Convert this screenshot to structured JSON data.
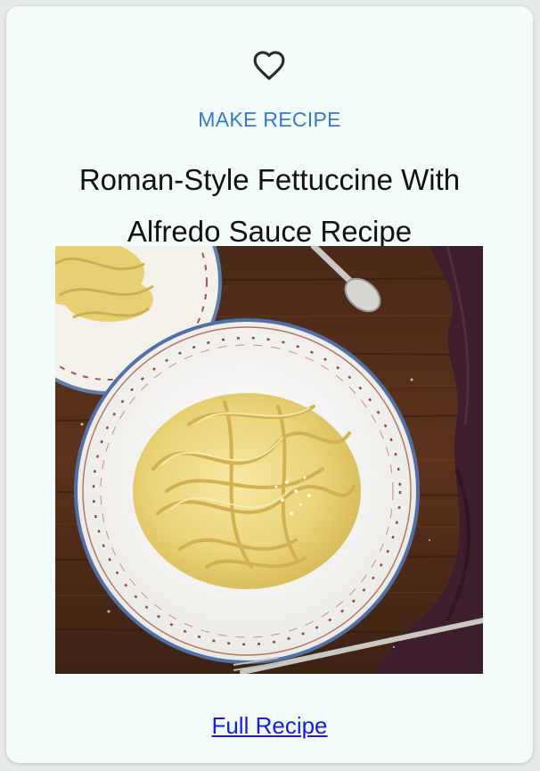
{
  "card": {
    "favorite_icon": "heart-outline-icon",
    "kicker": "MAKE RECIPE",
    "title": "Roman-Style Fettuccine With Alfredo Sauce Recipe",
    "image_alt": "Roman-Style Fettuccine With Alfredo Sauce",
    "link_label": "Full Recipe"
  },
  "colors": {
    "card_bg": "#f2fdfb",
    "kicker": "#3a79c8",
    "link": "#1a1ae6",
    "title": "#111111"
  }
}
